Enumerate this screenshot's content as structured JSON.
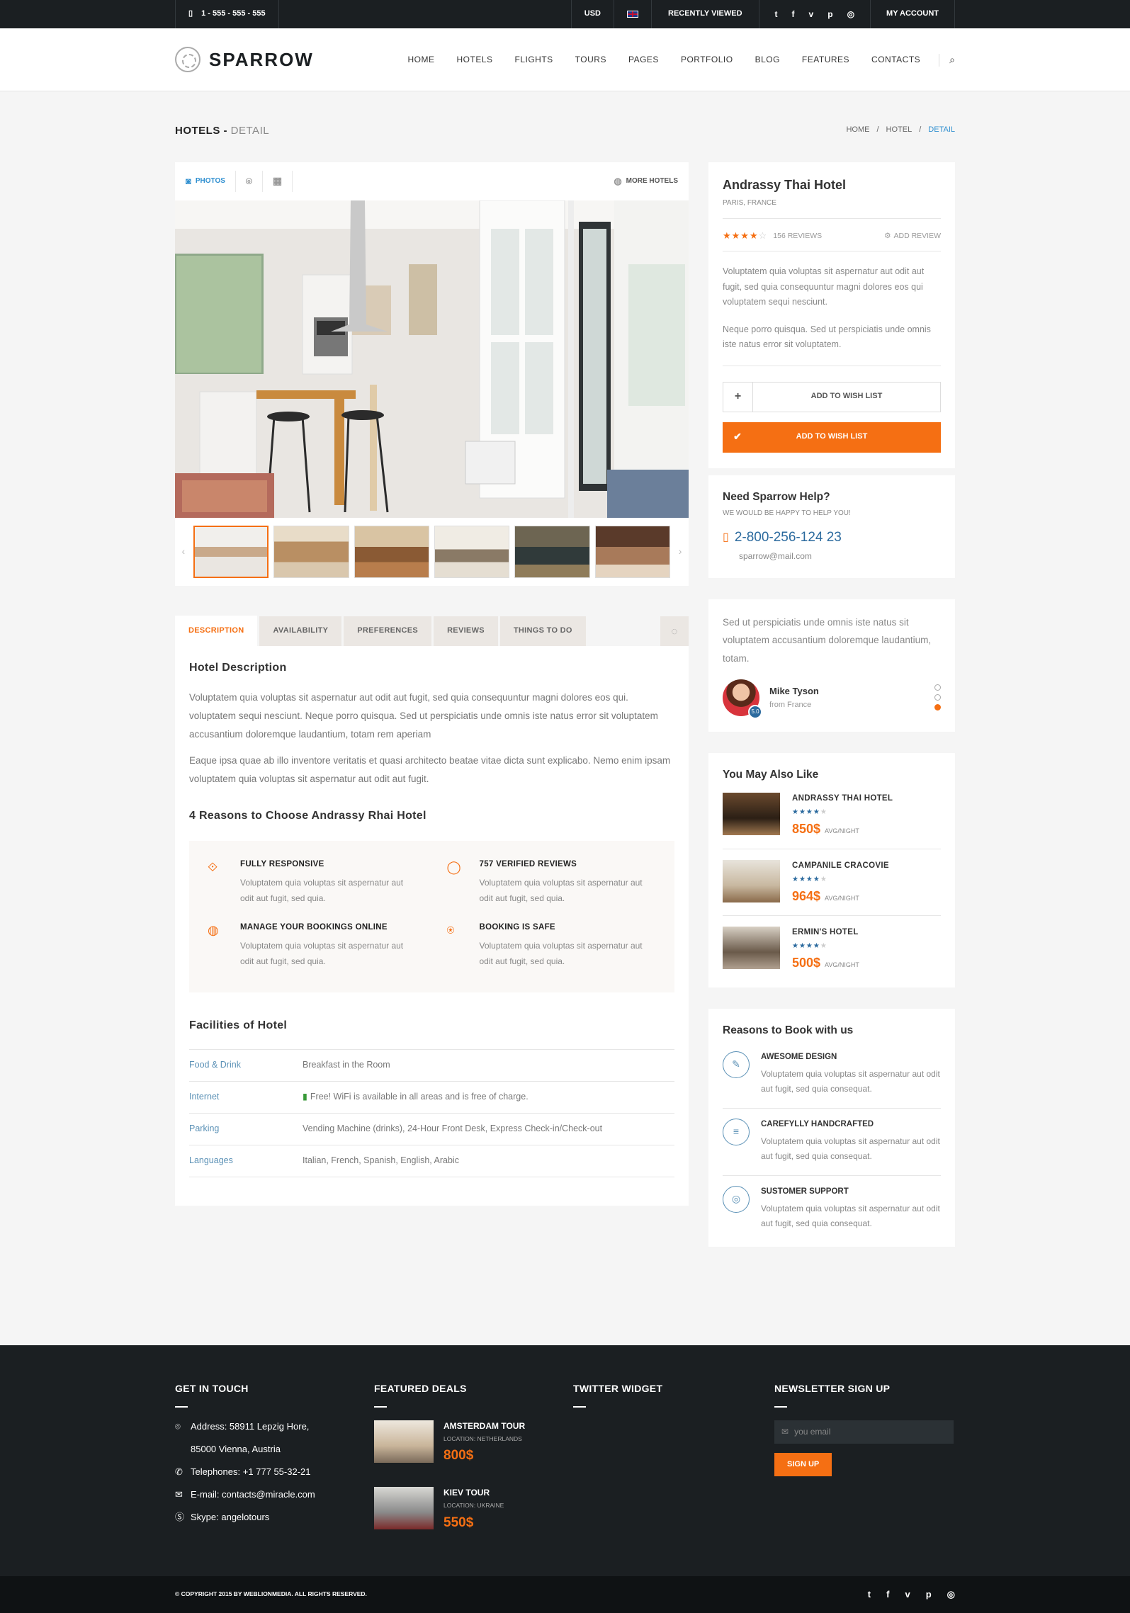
{
  "topbar": {
    "phone": "1 - 555 - 555 - 555",
    "currency": "USD",
    "recently": "RECENTLY VIEWED",
    "social": [
      "t",
      "f",
      "v",
      "p",
      "◎"
    ],
    "account": "MY ACCOUNT"
  },
  "brand": "SPARROW",
  "nav": [
    "HOME",
    "HOTELS",
    "FLIGHTS",
    "TOURS",
    "PAGES",
    "PORTFOLIO",
    "BLOG",
    "FEATURES",
    "CONTACTS"
  ],
  "page": {
    "title": "HOTELS -",
    "title_sub": "DETAIL",
    "crumbs": [
      "HOME",
      "/",
      "HOTEL",
      "/",
      "DETAIL"
    ]
  },
  "gallery": {
    "photos": "PHOTOS",
    "more": "MORE HOTELS"
  },
  "tabs": [
    "DESCRIPTION",
    "AVAILABILITY",
    "PREFERENCES",
    "REVIEWS",
    "THINGS TO DO"
  ],
  "desc": {
    "h": "Hotel Description",
    "p1": "Voluptatem quia voluptas sit aspernatur aut odit aut fugit, sed quia consequuntur magni dolores eos qui. voluptatem sequi nesciunt. Neque porro quisqua. Sed ut perspiciatis unde omnis iste natus error sit voluptatem accusantium doloremque laudantium, totam rem aperiam",
    "p2": "Eaque ipsa quae ab illo inventore veritatis et quasi architecto beatae vitae dicta sunt explicabo. Nemo enim ipsam voluptatem quia voluptas sit aspernatur aut odit aut fugit.",
    "h2": "4 Reasons to Choose Andrassy Rhai Hotel",
    "reasons": [
      {
        "t": "FULLY RESPONSIVE",
        "d": "Voluptatem quia voluptas sit aspernatur aut odit aut fugit, sed quia."
      },
      {
        "t": "757 VERIFIED REVIEWS",
        "d": "Voluptatem quia voluptas sit aspernatur aut odit aut fugit, sed quia."
      },
      {
        "t": "MANAGE YOUR BOOKINGS ONLINE",
        "d": "Voluptatem quia voluptas sit aspernatur aut odit aut fugit, sed quia."
      },
      {
        "t": "BOOKING IS SAFE",
        "d": "Voluptatem quia voluptas sit aspernatur aut odit aut fugit, sed quia."
      }
    ],
    "h3": "Facilities of Hotel",
    "facilities": [
      {
        "k": "Food & Drink",
        "v": "Breakfast in the Room"
      },
      {
        "k": "Internet",
        "v": "Free! WiFi is available in all areas and is free of charge."
      },
      {
        "k": "Parking",
        "v": "Vending Machine (drinks), 24-Hour Front Desk, Express Check-in/Check-out"
      },
      {
        "k": "Languages",
        "v": "Italian, French, Spanish, English, Arabic"
      }
    ]
  },
  "hotel": {
    "name": "Andrassy Thai Hotel",
    "loc": "PARIS, FRANCE",
    "rating": 4,
    "reviews": "156 REVIEWS",
    "add": "ADD REVIEW",
    "p1": "Voluptatem quia voluptas sit aspernatur aut odit aut fugit, sed quia consequuntur magni dolores eos qui voluptatem sequi nesciunt.",
    "p2": "Neque porro quisqua. Sed ut perspiciatis unde omnis iste natus error sit voluptatem.",
    "wish": "ADD TO WISH LIST",
    "wish2": "ADD TO WISH LIST"
  },
  "help": {
    "h": "Need Sparrow Help?",
    "sub": "WE WOULD BE HAPPY TO HELP YOU!",
    "phone": "2-800-256-124 23",
    "mail": "sparrow@mail.com"
  },
  "testimonial": {
    "q": "Sed ut perspiciatis unde omnis iste natus sit voluptatem accusantium doloremque laudantium, totam.",
    "name": "Mike Tyson",
    "from": "from France",
    "score": "5.0"
  },
  "alsolike": {
    "h": "You May Also Like",
    "unit": "AVG/NIGHT",
    "items": [
      {
        "name": "ANDRASSY THAI HOTEL",
        "price": "850$",
        "rating": 4
      },
      {
        "name": "CAMPANILE CRACOVIE",
        "price": "964$",
        "rating": 4
      },
      {
        "name": "ERMIN'S HOTEL",
        "price": "500$",
        "rating": 4
      }
    ]
  },
  "book": {
    "h": "Reasons to Book with us",
    "items": [
      {
        "t": "AWESOME DESIGN",
        "d": "Voluptatem quia voluptas sit aspernatur aut odit aut fugit, sed quia consequat."
      },
      {
        "t": "CAREFYLLY HANDCRAFTED",
        "d": "Voluptatem quia voluptas sit aspernatur aut odit aut fugit, sed quia consequat."
      },
      {
        "t": "SUSTOMER SUPPORT",
        "d": "Voluptatem quia voluptas sit aspernatur aut odit aut fugit, sed quia consequat."
      }
    ]
  },
  "footer": {
    "c1": "GET IN TOUCH",
    "addr1": "Address: 58911 Lepzig Hore,",
    "addr2": "85000 Vienna, Austria",
    "tel": "Telephones: +1 777 55-32-21",
    "email": "E-mail: contacts@miracle.com",
    "skype": "Skype: angelotours",
    "c2": "FEATURED DEALS",
    "deals": [
      {
        "t": "AMSTERDAM TOUR",
        "l": "LOCATION: NETHERLANDS",
        "p": "800$"
      },
      {
        "t": "KIEV TOUR",
        "l": "LOCATION: UKRAINE",
        "p": "550$"
      }
    ],
    "c3": "TWITTER WIDGET",
    "c4": "NEWSLETTER SIGN UP",
    "ph": "you email",
    "btn": "SIGN UP",
    "copy": "© COPYRIGHT 2015 BY WEBLIONMEDIA. ALL RIGHTS RESERVED."
  }
}
